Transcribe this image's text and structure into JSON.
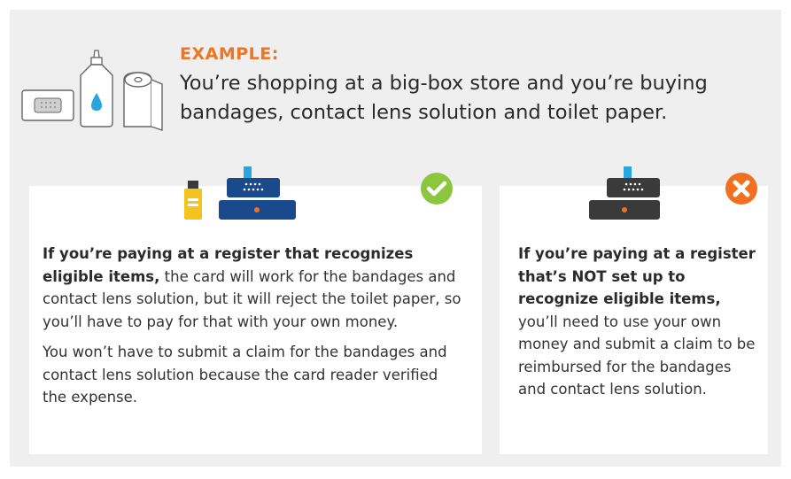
{
  "example": {
    "label": "EXAMPLE:",
    "text": "You’re shopping at a big-box store and you’re buying bandages, contact lens solution and toilet paper."
  },
  "left_card": {
    "bold": "If you’re paying at a register that recognizes eligible items,",
    "rest": " the card will work for the bandages and contact lens solution, but it will reject the toilet paper, so you’ll have to pay for that with your own money.",
    "paragraph2": "You won’t have to submit a claim for the bandages and contact lens solution because the card reader verified the expense.",
    "status_icon": "check-icon"
  },
  "right_card": {
    "bold": "If you’re paying at a register that’s NOT set up to recognize eligible items,",
    "rest": " you’ll need to use your own money and submit a claim to be reimbursed for the bandages and contact lens solution.",
    "status_icon": "x-icon"
  },
  "colors": {
    "background_frame": "#efefef",
    "accent_orange": "#ee7523",
    "check_green": "#8cc63f",
    "x_orange": "#f26f21",
    "register_left": "#1b4a8c",
    "register_right": "#3a3a3a",
    "screen_blue": "#2aa6df",
    "bottle_yellow": "#f5c31d"
  }
}
